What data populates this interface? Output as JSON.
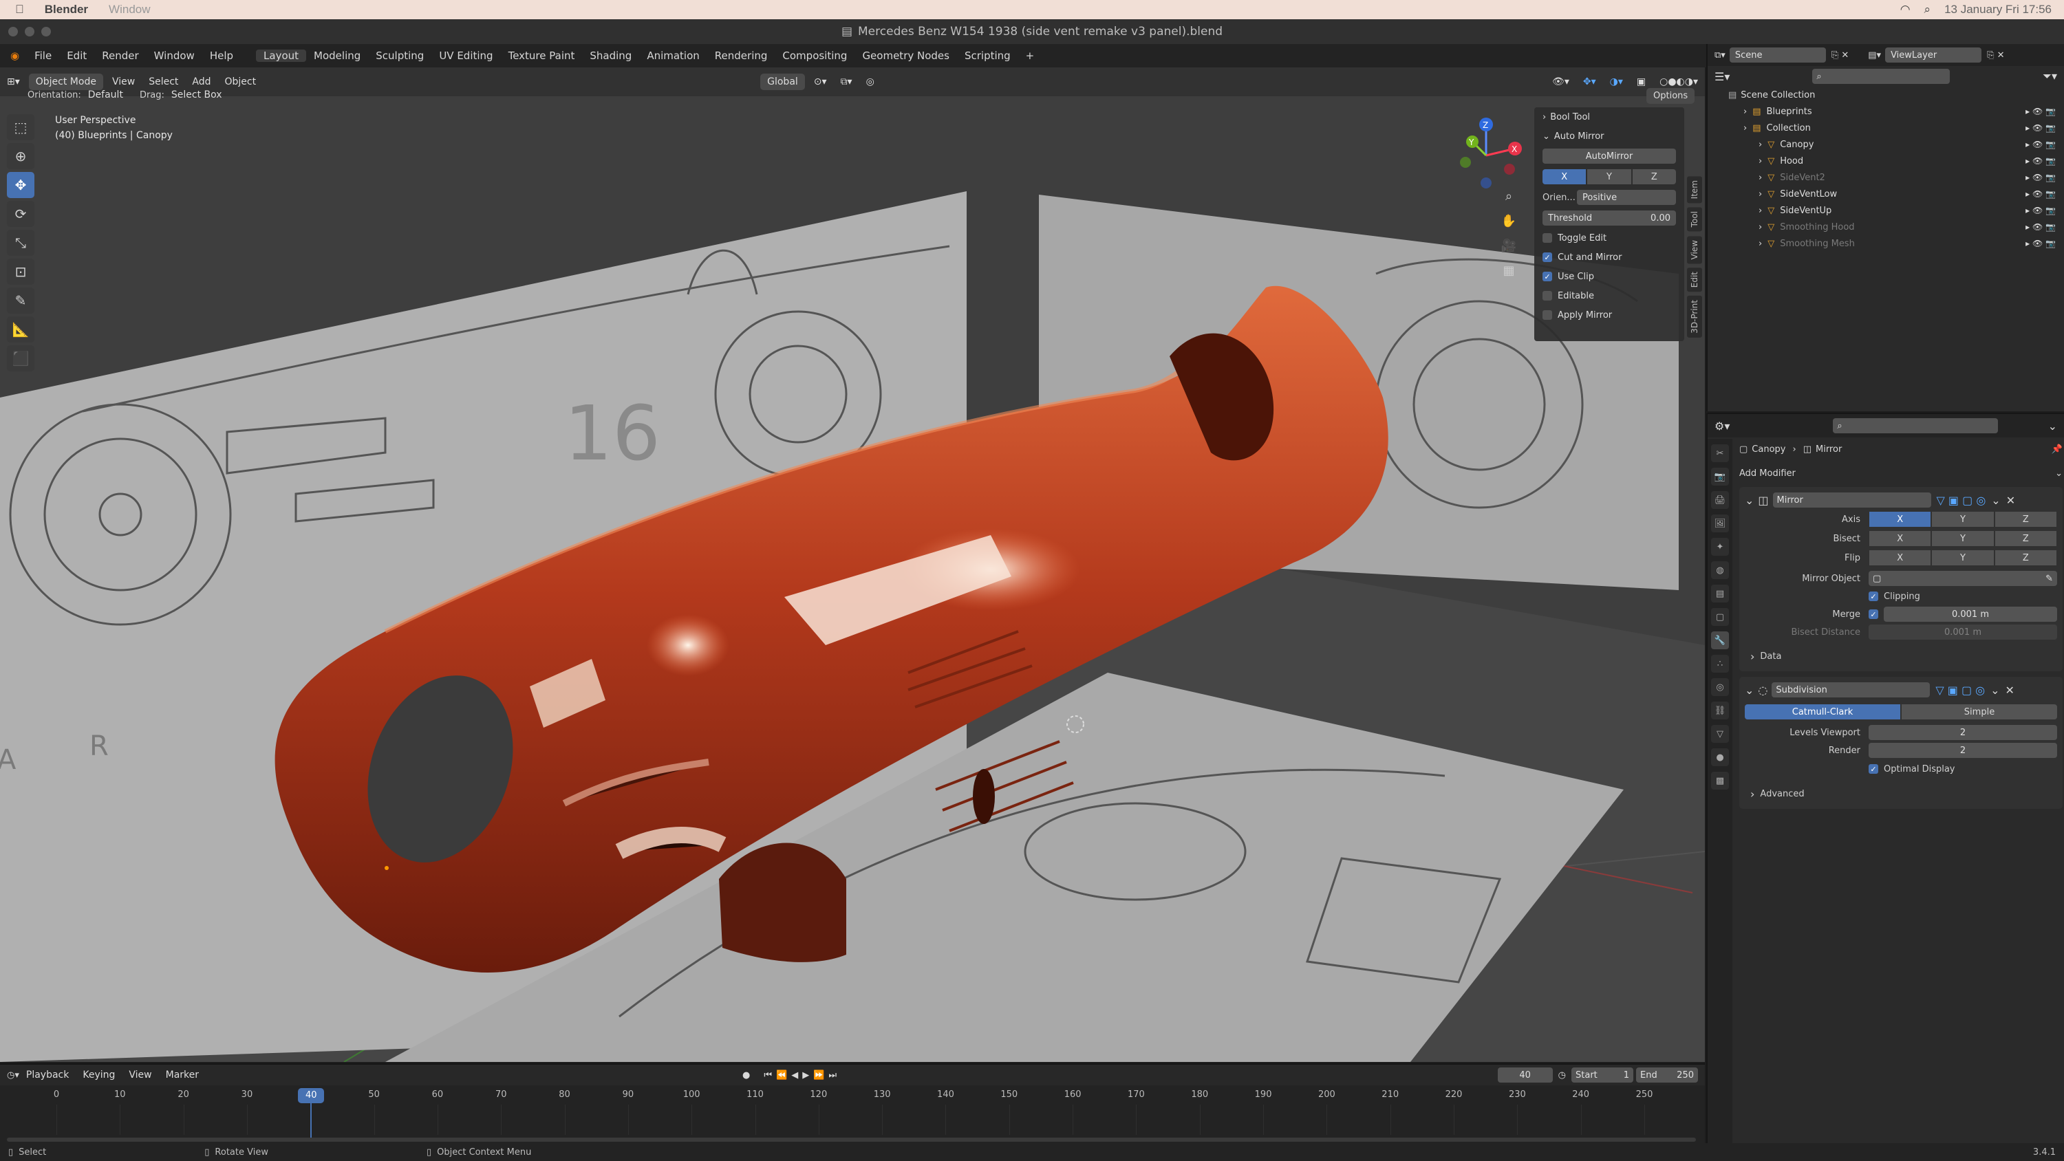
{
  "mac": {
    "app": "Blender",
    "menu": "Window",
    "datetime": "13 January Fri 17:56"
  },
  "window": {
    "title": "Mercedes Benz W154 1938 (side vent remake v3 panel).blend"
  },
  "menus": [
    "File",
    "Edit",
    "Render",
    "Window",
    "Help"
  ],
  "workspaces": [
    "Layout",
    "Modeling",
    "Sculpting",
    "UV Editing",
    "Texture Paint",
    "Shading",
    "Animation",
    "Rendering",
    "Compositing",
    "Geometry Nodes",
    "Scripting"
  ],
  "viewport": {
    "mode": "Object Mode",
    "view": "View",
    "select": "Select",
    "add": "Add",
    "object": "Object",
    "orientation_label": "Orientation:",
    "orientation_value": "Default",
    "drag_label": "Drag:",
    "drag_value": "Select Box",
    "transform": "Global",
    "options": "Options",
    "info1": "User Perspective",
    "info2": "(40) Blueprints | Canopy",
    "blueprint_numbers": [
      "16",
      "16"
    ],
    "blueprint_letters": [
      "A",
      "R"
    ],
    "gizmo": {
      "x": "X",
      "y": "Y",
      "z": "Z"
    }
  },
  "npanel": {
    "bool_tool": "Bool Tool",
    "auto_mirror": "Auto Mirror",
    "automirror_btn": "AutoMirror",
    "axes": [
      "X",
      "Y",
      "Z"
    ],
    "orientation_label": "Orien...",
    "orientation_value": "Positive",
    "threshold_label": "Threshold",
    "threshold_value": "0.00",
    "checks": [
      {
        "label": "Toggle Edit",
        "on": false
      },
      {
        "label": "Cut and Mirror",
        "on": true
      },
      {
        "label": "Use Clip",
        "on": true
      },
      {
        "label": "Editable",
        "on": false
      },
      {
        "label": "Apply Mirror",
        "on": false
      }
    ],
    "tabs": [
      "Item",
      "Tool",
      "View",
      "Edit",
      "3D-Print"
    ]
  },
  "outliner": {
    "scene": "Scene",
    "viewlayer": "ViewLayer",
    "root": "Scene Collection",
    "items": [
      {
        "name": "Blueprints",
        "indent": 1,
        "dim": false
      },
      {
        "name": "Collection",
        "indent": 1,
        "dim": false
      },
      {
        "name": "Canopy",
        "indent": 2,
        "dim": false
      },
      {
        "name": "Hood",
        "indent": 2,
        "dim": false
      },
      {
        "name": "SideVent2",
        "indent": 2,
        "dim": true
      },
      {
        "name": "SideVentLow",
        "indent": 2,
        "dim": false
      },
      {
        "name": "SideVentUp",
        "indent": 2,
        "dim": false
      },
      {
        "name": "Smoothing Hood",
        "indent": 2,
        "dim": true
      },
      {
        "name": "Smoothing Mesh",
        "indent": 2,
        "dim": true
      }
    ]
  },
  "properties": {
    "breadcrumb_obj": "Canopy",
    "breadcrumb_mod": "Mirror",
    "add_modifier": "Add Modifier",
    "mirror": {
      "name": "Mirror",
      "axis_label": "Axis",
      "bisect_label": "Bisect",
      "flip_label": "Flip",
      "axes": [
        "X",
        "Y",
        "Z"
      ],
      "mirror_object_label": "Mirror Object",
      "clipping": "Clipping",
      "merge_label": "Merge",
      "merge_value": "0.001 m",
      "bisect_distance_label": "Bisect Distance",
      "bisect_distance_value": "0.001 m",
      "data": "Data"
    },
    "subdivision": {
      "name": "Subdivision",
      "catmull": "Catmull-Clark",
      "simple": "Simple",
      "levels_label": "Levels Viewport",
      "levels_value": "2",
      "render_label": "Render",
      "render_value": "2",
      "optimal": "Optimal Display",
      "advanced": "Advanced"
    }
  },
  "timeline": {
    "playback": "Playback",
    "keying": "Keying",
    "view": "View",
    "marker": "Marker",
    "current": "40",
    "start_label": "Start",
    "start": "1",
    "end_label": "End",
    "end": "250",
    "ticks": [
      "0",
      "10",
      "20",
      "30",
      "40",
      "50",
      "60",
      "70",
      "80",
      "90",
      "100",
      "110",
      "120",
      "130",
      "140",
      "150",
      "160",
      "170",
      "180",
      "190",
      "200",
      "210",
      "220",
      "230",
      "240",
      "250"
    ],
    "frame_current_value": 40,
    "frame_max": 250
  },
  "status": {
    "select": "Select",
    "rotate": "Rotate View",
    "context": "Object Context Menu",
    "version": "3.4.1"
  },
  "colors": {
    "accent": "#4772b3",
    "car": "#b3391c",
    "bg": "#3e3e3e"
  }
}
